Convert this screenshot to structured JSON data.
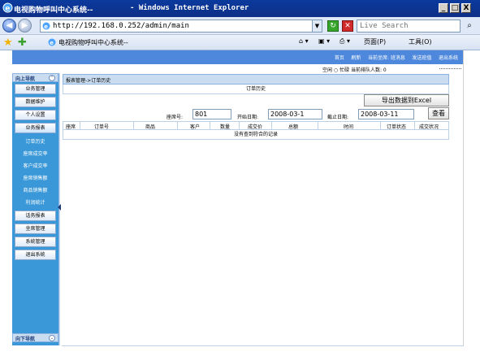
{
  "window": {
    "title": "电视购物呼叫中心系统--",
    "app_suffix": "- Windows Internet Explorer",
    "min": "_",
    "max": "□",
    "close": "X"
  },
  "browser": {
    "back": "◀",
    "forward": "▶",
    "url": "http://192.168.0.252/admin/main",
    "search_placeholder": "Live Search",
    "tab_title": "电视购物呼叫中心系统--",
    "page_menu": "页面(P)",
    "tools_menu": "工具(O)"
  },
  "header": {
    "links": [
      "首页",
      "刷新",
      "当前坐席: 班消息",
      "发送班值",
      "退出系统"
    ]
  },
  "status": {
    "text": "空闲 ○ 忙碌  当前排队人数: 0"
  },
  "sidebar": {
    "top_title": "向上导航",
    "bottom_title": "向下导航",
    "toggle_up": "⌃",
    "toggle_down": "⌄",
    "items": [
      {
        "label": "业务管理"
      },
      {
        "label": "数据维护"
      },
      {
        "label": "个人设置"
      },
      {
        "label": "业务报表"
      }
    ],
    "subitems": [
      {
        "label": "订单历史"
      },
      {
        "label": "座席成交率"
      },
      {
        "label": "客户成交率"
      },
      {
        "label": "座席销售额"
      },
      {
        "label": "商品销售额"
      },
      {
        "label": "利润统计"
      }
    ],
    "items2": [
      {
        "label": "话务报表"
      },
      {
        "label": "坐席管理"
      },
      {
        "label": "系统管理"
      },
      {
        "label": "退出系统"
      }
    ]
  },
  "main": {
    "breadcrumb": "报表管理->订单历史",
    "panel_title": "订单历史",
    "export_label": "导出数据到Excel",
    "filters": {
      "seat_label": "座席号:",
      "seat_value": "801",
      "start_label": "开始日期:",
      "start_value": "2008-03-1",
      "end_label": "截止日期:",
      "end_value": "2008-03-11",
      "view_label": "查看"
    },
    "table": {
      "columns": [
        "座席",
        "订单号",
        "商品",
        "客户",
        "数量",
        "成交价",
        "总额",
        "时间",
        "订单状态",
        "成交状况"
      ],
      "empty_text": "没有查到符合的记录"
    }
  }
}
